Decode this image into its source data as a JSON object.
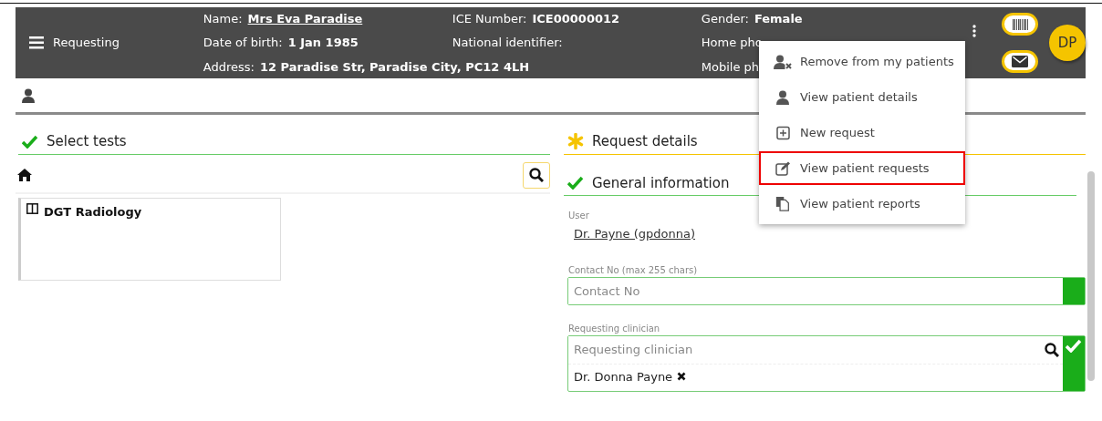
{
  "header": {
    "title": "Requesting",
    "columns": [
      [
        {
          "label": "Name:",
          "value": "Mrs Eva Paradise",
          "link": true
        },
        {
          "label": "Date of birth:",
          "value": "1 Jan 1985"
        },
        {
          "label": "Address:",
          "value": "12 Paradise Str, Paradise City, PC12 4LH"
        }
      ],
      [
        {
          "label": "ICE Number:",
          "value": "ICE00000012"
        },
        {
          "label": "National identifier:"
        }
      ],
      [
        {
          "label": "Gender:",
          "value": "Female"
        },
        {
          "label": "Home pho"
        },
        {
          "label": "Mobile ph"
        }
      ]
    ],
    "avatar": "DP"
  },
  "menu": [
    {
      "kind": "remove",
      "label": "Remove from my patients",
      "highlighted": false
    },
    {
      "kind": "details",
      "label": "View patient details",
      "highlighted": false
    },
    {
      "kind": "new",
      "label": "New request",
      "highlighted": false
    },
    {
      "kind": "requests",
      "label": "View patient requests",
      "highlighted": true
    },
    {
      "kind": "reports",
      "label": "View patient reports",
      "highlighted": false
    }
  ],
  "select_tests": {
    "title": "Select tests",
    "items": [
      {
        "label": "DGT Radiology"
      }
    ]
  },
  "request_details": {
    "title": "Request details",
    "section": "General information",
    "user": {
      "label": "User",
      "value": "Dr. Payne (gpdonna)"
    },
    "contact": {
      "label": "Contact No (max 255 chars)",
      "placeholder": "Contact No"
    },
    "clinician": {
      "label": "Requesting clinician",
      "placeholder": "Requesting clinician",
      "selected_value": "Dr. Donna Payne"
    }
  }
}
